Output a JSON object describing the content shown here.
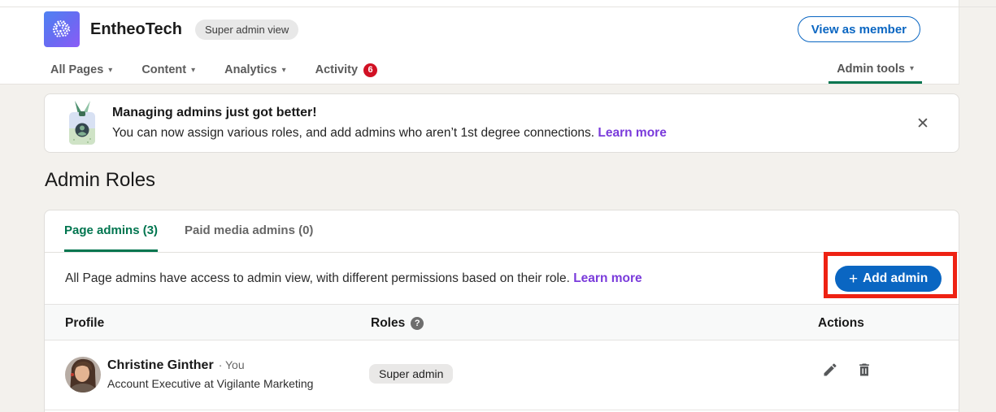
{
  "colors": {
    "accent_blue": "#0a66c2",
    "accent_green": "#01754f",
    "link_purple": "#7a3bdb",
    "notification_red": "#d11124",
    "highlight_red": "#ee2213",
    "page_background": "#f3f1ed"
  },
  "icons": {
    "caret": "▾",
    "close": "✕",
    "help": "?"
  },
  "header": {
    "company_name": "EntheoTech",
    "view_badge": "Super admin view",
    "view_as_member_label": "View as member",
    "nav": {
      "items": [
        {
          "label": "All Pages"
        },
        {
          "label": "Content"
        },
        {
          "label": "Analytics"
        },
        {
          "label": "Activity"
        }
      ],
      "activity_badge": "6",
      "admin_tools_label": "Admin tools"
    }
  },
  "banner": {
    "title": "Managing admins just got better!",
    "body": "You can now assign various roles, and add admins who aren’t 1st degree connections. ",
    "link": "Learn more"
  },
  "main": {
    "title": "Admin Roles",
    "tabs": [
      {
        "label": "Page admins (3)",
        "active": true
      },
      {
        "label": "Paid media admins (0)",
        "active": false
      }
    ],
    "description": "All Page admins have access to admin view, with different permissions based on their role. ",
    "description_link": "Learn more",
    "add_admin": {
      "plus": "+",
      "label": "Add admin"
    },
    "table": {
      "columns": [
        "Profile",
        "Roles",
        "Actions"
      ],
      "rows": [
        {
          "name": "Christine Ginther",
          "you_label": "· You",
          "subtitle": "Account Executive at Vigilante Marketing",
          "role": "Super admin"
        }
      ]
    }
  }
}
